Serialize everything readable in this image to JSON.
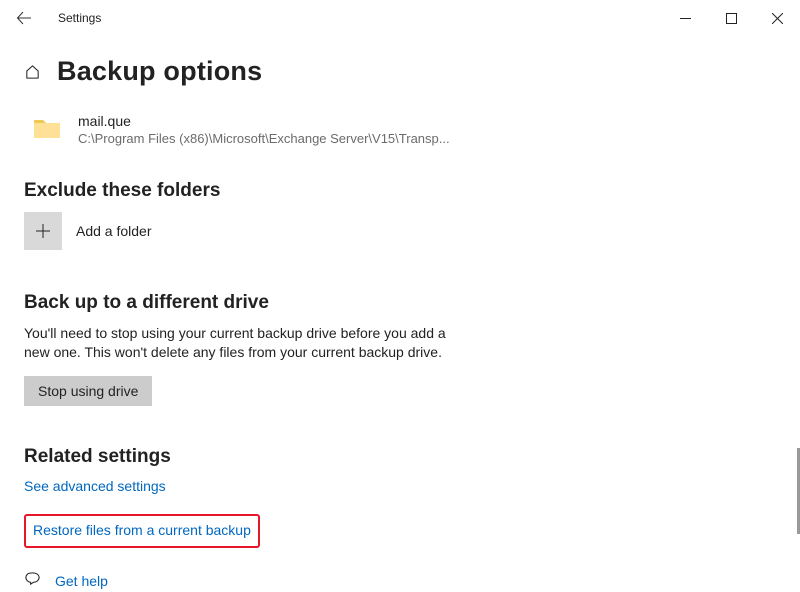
{
  "titlebar": {
    "app_title": "Settings"
  },
  "header": {
    "page_title": "Backup options"
  },
  "folder_item": {
    "name": "mail.que",
    "path": "C:\\Program Files (x86)\\Microsoft\\Exchange Server\\V15\\Transp..."
  },
  "exclude_section": {
    "heading": "Exclude these folders",
    "add_label": "Add a folder"
  },
  "different_drive_section": {
    "heading": "Back up to a different drive",
    "description": "You'll need to stop using your current backup drive before you add a new one. This won't delete any files from your current backup drive.",
    "button_label": "Stop using drive"
  },
  "related_section": {
    "heading": "Related settings",
    "link_advanced": "See advanced settings",
    "link_restore": "Restore files from a current backup"
  },
  "help": {
    "label": "Get help"
  }
}
